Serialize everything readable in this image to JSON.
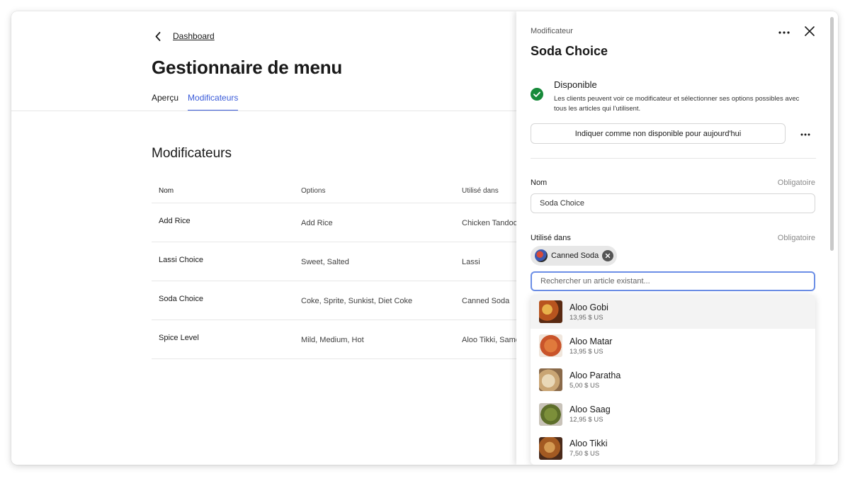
{
  "header": {
    "breadcrumb_label": "Dashboard",
    "title": "Gestionnaire de menu",
    "tabs": [
      {
        "label": "Aperçu",
        "active": false
      },
      {
        "label": "Modificateurs",
        "active": true
      }
    ]
  },
  "main": {
    "section_title": "Modificateurs",
    "columns": [
      "Nom",
      "Options",
      "Utilisé dans"
    ],
    "rows": [
      {
        "name": "Add Rice",
        "options": "Add Rice",
        "used_in": "Chicken Tandoori"
      },
      {
        "name": "Lassi Choice",
        "options": "Sweet, Salted",
        "used_in": "Lassi"
      },
      {
        "name": "Soda Choice",
        "options": "Coke, Sprite, Sunkist, Diet Coke",
        "used_in": "Canned Soda"
      },
      {
        "name": "Spice Level",
        "options": "Mild, Medium, Hot",
        "used_in": "Aloo Tikki, Samosa"
      }
    ]
  },
  "panel": {
    "eyebrow": "Modificateur",
    "title": "Soda Choice",
    "more_icon": "more-horizontal-icon",
    "close_icon": "close-icon",
    "availability": {
      "title": "Disponible",
      "description": "Les clients peuvent voir ce modificateur et sélectionner ses options possibles avec tous les articles qui l'utilisent.",
      "icon": "check-circle-icon",
      "status_color": "#178a3a"
    },
    "unavailable_button": "Indiquer comme non disponible pour aujourd'hui",
    "name_field": {
      "label": "Nom",
      "required": "Obligatoire",
      "value": "Soda Choice"
    },
    "used_in_field": {
      "label": "Utilisé dans",
      "required": "Obligatoire",
      "chip": "Canned Soda"
    },
    "search": {
      "placeholder": "Rechercher un article existant..."
    },
    "results": [
      {
        "name": "Aloo Gobi",
        "price": "13,95 $ US"
      },
      {
        "name": "Aloo Matar",
        "price": "13,95 $ US"
      },
      {
        "name": "Aloo Paratha",
        "price": "5,00 $ US"
      },
      {
        "name": "Aloo Saag",
        "price": "12,95 $ US"
      },
      {
        "name": "Aloo Tikki",
        "price": "7,50 $ US"
      }
    ]
  },
  "colors": {
    "accent": "#3a5bd9",
    "focus": "#6b8ee6"
  }
}
